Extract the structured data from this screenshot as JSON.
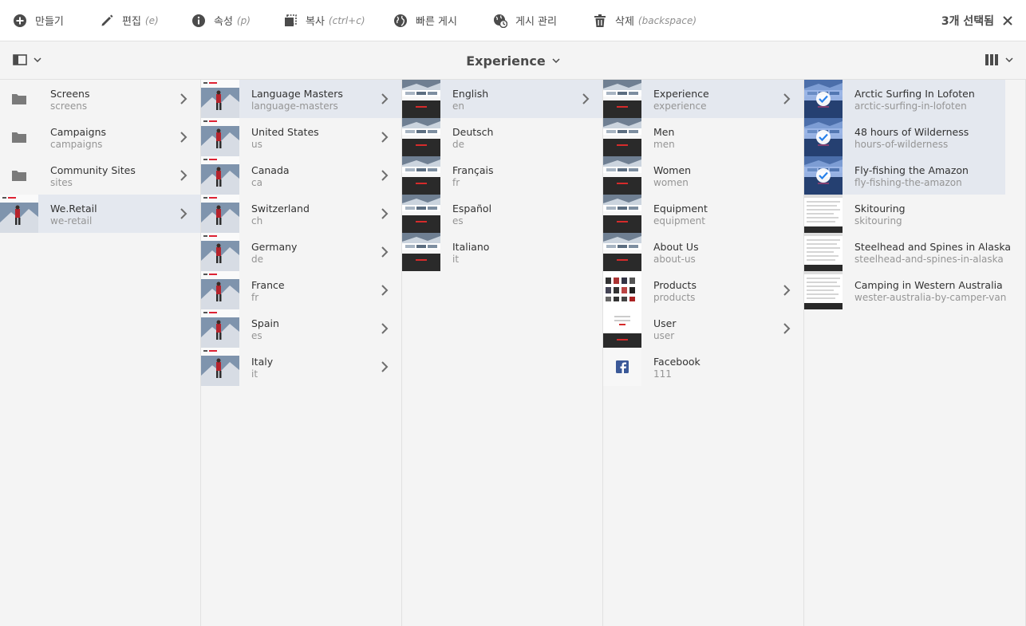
{
  "toolbar": {
    "create": {
      "label": "만들기",
      "shortcut": ""
    },
    "edit": {
      "label": "편집",
      "shortcut": "(e)"
    },
    "properties": {
      "label": "속성",
      "shortcut": "(p)"
    },
    "copy": {
      "label": "복사",
      "shortcut": "(ctrl+c)"
    },
    "quick_publish": {
      "label": "빠른 게시",
      "shortcut": ""
    },
    "manage_publication": {
      "label": "게시 관리",
      "shortcut": ""
    },
    "delete": {
      "label": "삭제",
      "shortcut": "(backspace)"
    },
    "selection_count": "3개 선택됨"
  },
  "subbar": {
    "title": "Experience"
  },
  "colors": {
    "accent": "#2680eb",
    "active_row": "#e4e8ef",
    "background": "#f4f4f4"
  },
  "columns": [
    {
      "items": [
        {
          "title": "Screens",
          "sub": "screens",
          "thumb": "folder-icon",
          "arrow": true,
          "active": false,
          "selected": false
        },
        {
          "title": "Campaigns",
          "sub": "campaigns",
          "thumb": "folder-icon",
          "arrow": true,
          "active": false,
          "selected": false
        },
        {
          "title": "Community Sites",
          "sub": "sites",
          "thumb": "folder-icon",
          "arrow": true,
          "active": false,
          "selected": false
        },
        {
          "title": "We.Retail",
          "sub": "we-retail",
          "thumb": "hero",
          "arrow": true,
          "active": true,
          "selected": false
        }
      ]
    },
    {
      "items": [
        {
          "title": "Language Masters",
          "sub": "language-masters",
          "thumb": "hero",
          "arrow": true,
          "active": true,
          "selected": false
        },
        {
          "title": "United States",
          "sub": "us",
          "thumb": "hero",
          "arrow": true,
          "active": false,
          "selected": false
        },
        {
          "title": "Canada",
          "sub": "ca",
          "thumb": "hero",
          "arrow": true,
          "active": false,
          "selected": false
        },
        {
          "title": "Switzerland",
          "sub": "ch",
          "thumb": "hero",
          "arrow": true,
          "active": false,
          "selected": false
        },
        {
          "title": "Germany",
          "sub": "de",
          "thumb": "hero",
          "arrow": true,
          "active": false,
          "selected": false
        },
        {
          "title": "France",
          "sub": "fr",
          "thumb": "hero",
          "arrow": true,
          "active": false,
          "selected": false
        },
        {
          "title": "Spain",
          "sub": "es",
          "thumb": "hero",
          "arrow": true,
          "active": false,
          "selected": false
        },
        {
          "title": "Italy",
          "sub": "it",
          "thumb": "hero",
          "arrow": true,
          "active": false,
          "selected": false
        }
      ]
    },
    {
      "items": [
        {
          "title": "English",
          "sub": "en",
          "thumb": "page",
          "arrow": true,
          "active": true,
          "selected": false
        },
        {
          "title": "Deutsch",
          "sub": "de",
          "thumb": "page",
          "arrow": false,
          "active": false,
          "selected": false
        },
        {
          "title": "Français",
          "sub": "fr",
          "thumb": "page",
          "arrow": false,
          "active": false,
          "selected": false
        },
        {
          "title": "Español",
          "sub": "es",
          "thumb": "page",
          "arrow": false,
          "active": false,
          "selected": false
        },
        {
          "title": "Italiano",
          "sub": "it",
          "thumb": "page",
          "arrow": false,
          "active": false,
          "selected": false
        }
      ]
    },
    {
      "items": [
        {
          "title": "Experience",
          "sub": "experience",
          "thumb": "page",
          "arrow": true,
          "active": true,
          "selected": false
        },
        {
          "title": "Men",
          "sub": "men",
          "thumb": "page",
          "arrow": false,
          "active": false,
          "selected": false
        },
        {
          "title": "Women",
          "sub": "women",
          "thumb": "page",
          "arrow": false,
          "active": false,
          "selected": false
        },
        {
          "title": "Equipment",
          "sub": "equipment",
          "thumb": "page",
          "arrow": false,
          "active": false,
          "selected": false
        },
        {
          "title": "About Us",
          "sub": "about-us",
          "thumb": "page",
          "arrow": false,
          "active": false,
          "selected": false
        },
        {
          "title": "Products",
          "sub": "products",
          "thumb": "products",
          "arrow": true,
          "active": false,
          "selected": false
        },
        {
          "title": "User",
          "sub": "user",
          "thumb": "user",
          "arrow": true,
          "active": false,
          "selected": false
        },
        {
          "title": "Facebook",
          "sub": "111",
          "thumb": "facebook",
          "arrow": false,
          "active": false,
          "selected": false
        }
      ]
    },
    {
      "items": [
        {
          "title": "Arctic Surfing In Lofoten",
          "sub": "arctic-surfing-in-lofoten",
          "thumb": "page",
          "arrow": false,
          "active": true,
          "selected": true
        },
        {
          "title": "48 hours of Wilderness",
          "sub": "hours-of-wilderness",
          "thumb": "page",
          "arrow": false,
          "active": true,
          "selected": true
        },
        {
          "title": "Fly-fishing the Amazon",
          "sub": "fly-fishing-the-amazon",
          "thumb": "page",
          "arrow": false,
          "active": true,
          "selected": true
        },
        {
          "title": "Skitouring",
          "sub": "skitouring",
          "thumb": "article",
          "arrow": false,
          "active": false,
          "selected": false
        },
        {
          "title": "Steelhead and Spines in Alaska",
          "sub": "steelhead-and-spines-in-alaska",
          "thumb": "article",
          "arrow": false,
          "active": false,
          "selected": false
        },
        {
          "title": "Camping in Western Australia",
          "sub": "wester-australia-by-camper-van",
          "thumb": "article",
          "arrow": false,
          "active": false,
          "selected": false
        }
      ]
    }
  ]
}
